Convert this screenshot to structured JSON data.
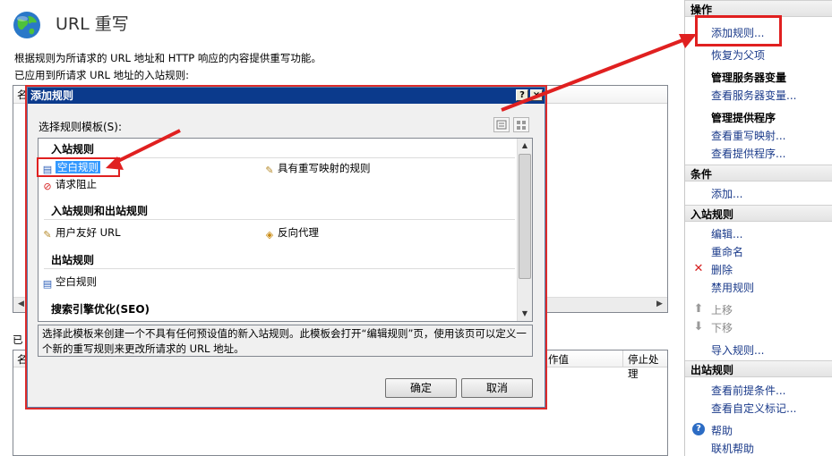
{
  "header": {
    "title": "URL 重写",
    "description": "根据规则为所请求的 URL 地址和 HTTP 响应的内容提供重写功能。",
    "applied_label": "已应用到所请求 URL 地址的入站规则:",
    "outbound_label": "已"
  },
  "outbound_grid": {
    "col_action_value": "作值",
    "col_stop": "停止处理",
    "col_first": "名"
  },
  "inbound_grid": {
    "col_first": "名"
  },
  "dialog": {
    "title": "添加规则",
    "help_btn": "?",
    "close_btn": "×",
    "template_label": "选择规则模板(S):",
    "groups": [
      {
        "title": "入站规则",
        "items": [
          "空白规则",
          "具有重写映射的规则",
          "请求阻止"
        ]
      },
      {
        "title": "入站规则和出站规则",
        "items": [
          "用户友好 URL",
          "反向代理"
        ]
      },
      {
        "title": "出站规则",
        "items": [
          "空白规则"
        ]
      },
      {
        "title": "搜索引擎优化(SEO)",
        "items": []
      }
    ],
    "description": "选择此模板来创建一个不具有任何预设值的新入站规则。此模板会打开“编辑规则”页，使用该页可以定义一个新的重写规则来更改所请求的 URL 地址。",
    "ok_label": "确定",
    "cancel_label": "取消"
  },
  "actions": {
    "sections": [
      {
        "title": "操作",
        "items": [
          "添加规则...",
          "恢复为父项"
        ]
      },
      {
        "title": "管理服务器变量",
        "items": [
          "查看服务器变量..."
        ]
      },
      {
        "title": "管理提供程序",
        "items": [
          "查看重写映射...",
          "查看提供程序..."
        ]
      },
      {
        "title": "条件",
        "items": [
          "添加..."
        ]
      },
      {
        "title": "入站规则",
        "items": [
          "编辑...",
          "重命名",
          "删除",
          "禁用规则",
          "上移",
          "下移",
          "导入规则..."
        ]
      },
      {
        "title": "出站规则",
        "items": [
          "查看前提条件...",
          "查看自定义标记..."
        ]
      },
      {
        "title": "",
        "items": [
          "帮助",
          "联机帮助"
        ]
      }
    ]
  },
  "colors": {
    "annotation": "#e02020",
    "title_bar": "#0b3a8c",
    "selection": "#3399ff"
  }
}
